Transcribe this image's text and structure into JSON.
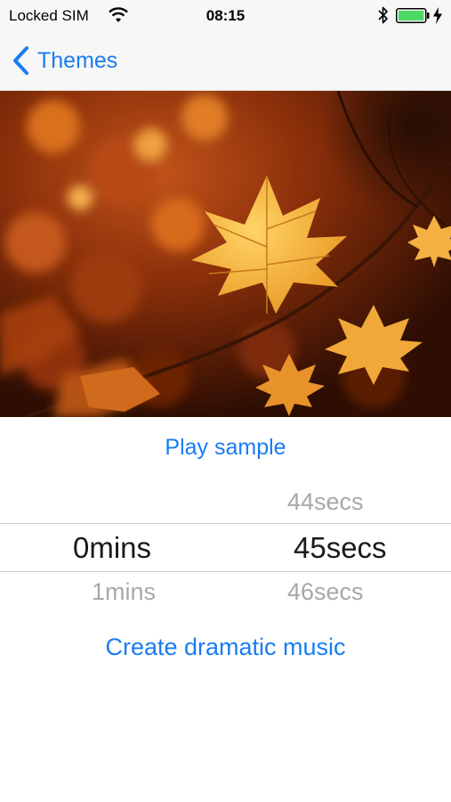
{
  "status_bar": {
    "carrier": "Locked SIM",
    "time": "08:15"
  },
  "nav": {
    "back_label": "Themes"
  },
  "colors": {
    "accent": "#1a7cf2",
    "battery": "#4cd964"
  },
  "hero": {
    "icon": "autumn-leaves-photo"
  },
  "play_sample_label": "Play sample",
  "picker": {
    "minutes": {
      "selected": "0mins",
      "below": "1mins"
    },
    "seconds": {
      "above": "44secs",
      "selected": "45secs",
      "below": "46secs"
    }
  },
  "create_label": "Create dramatic music"
}
